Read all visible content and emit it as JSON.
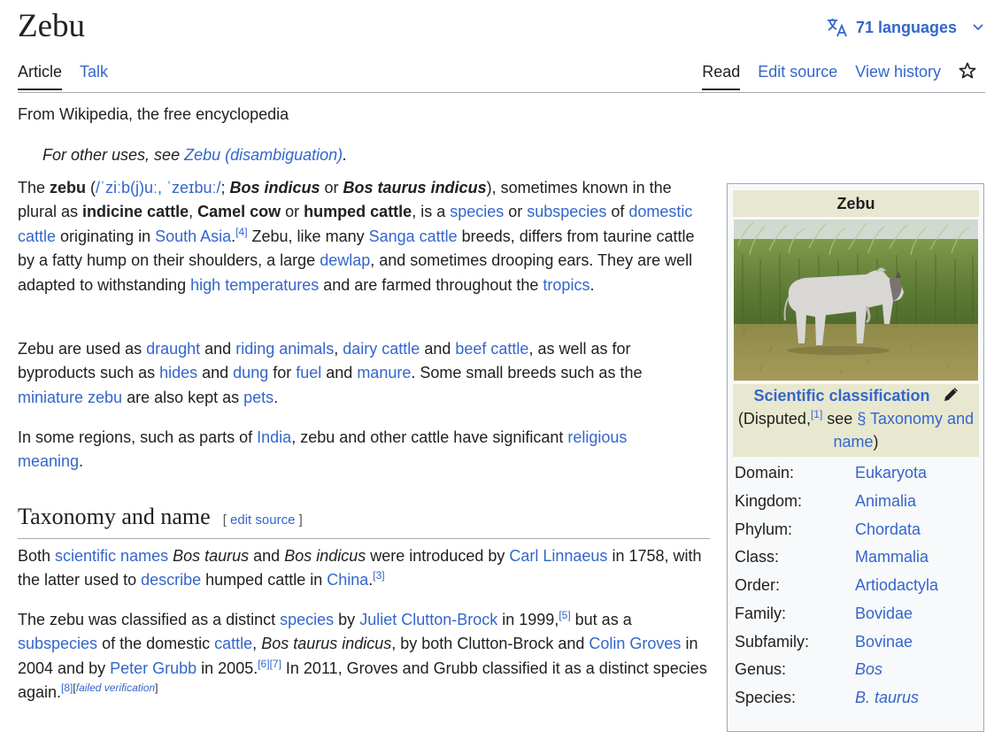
{
  "page": {
    "title": "Zebu",
    "languages": "71 languages",
    "tabs_left": [
      "Article",
      "Talk"
    ],
    "tabs_right": [
      "Read",
      "Edit source",
      "View history"
    ],
    "tagline": "From Wikipedia, the free encyclopedia",
    "hatnote_prefix": "For other uses, see ",
    "hatnote_link": "Zebu (disambiguation)",
    "hatnote_suffix": "."
  },
  "section": {
    "heading": "Taxonomy and name",
    "edit_open": "[ ",
    "edit_link": "edit source",
    "edit_close": " ]"
  },
  "infobox": {
    "title": "Zebu",
    "classification_heading": "Scientific classification",
    "disputed_prefix": "(Disputed,",
    "disputed_ref": "[1]",
    "disputed_mid": " see ",
    "disputed_link": "§ Taxonomy and name",
    "disputed_suffix": ")",
    "rows": [
      {
        "rank": "Domain:",
        "value": "Eukaryota"
      },
      {
        "rank": "Kingdom:",
        "value": "Animalia"
      },
      {
        "rank": "Phylum:",
        "value": "Chordata"
      },
      {
        "rank": "Class:",
        "value": "Mammalia"
      },
      {
        "rank": "Order:",
        "value": "Artiodactyla"
      },
      {
        "rank": "Family:",
        "value": "Bovidae"
      },
      {
        "rank": "Subfamily:",
        "value": "Bovinae"
      },
      {
        "rank": "Genus:",
        "value": "Bos"
      },
      {
        "rank": "Species:",
        "value": "B. taurus"
      }
    ]
  },
  "p1": {
    "t1": "The ",
    "b1": "zebu",
    "t2": " (",
    "ipa": "/ˈziːb(j)uː, ˈzeɪbuː/",
    "t3": "; ",
    "bi1": "Bos indicus",
    "t4": " or ",
    "bi2": "Bos taurus indicus",
    "t5": "), sometimes known in the plural as ",
    "b2": "indicine cattle",
    "t6": ", ",
    "b3": "Camel cow",
    "t7": " or ",
    "b4": "humped cattle",
    "t8": ", is a ",
    "l1": "species",
    "t9": " or ",
    "l2": "subspecies",
    "t10": " of ",
    "l3": "domestic cattle",
    "t11": " originating in ",
    "l4": "South Asia",
    "t12": ".",
    "r1": "[4]",
    "t13": " Zebu, like many ",
    "l5": "Sanga cattle",
    "t14": " breeds, differs from taurine cattle by a fatty hump on their shoulders, a large ",
    "l6": "dewlap",
    "t15": ", and sometimes drooping ears. They are well adapted to withstanding ",
    "l7": "high temperatures",
    "t16": " and are farmed throughout the ",
    "l8": "tropics",
    "t17": "."
  },
  "p2": {
    "t1": "Zebu are used as ",
    "l1": "draught",
    "t2": " and ",
    "l2": "riding animals",
    "t3": ", ",
    "l3": "dairy cattle",
    "t4": " and ",
    "l4": "beef cattle",
    "t5": ", as well as for byproducts such as ",
    "l5": "hides",
    "t6": " and ",
    "l6": "dung",
    "t7": " for ",
    "l7": "fuel",
    "t8": " and ",
    "l8": "manure",
    "t9": ". Some small breeds such as the ",
    "l9": "miniature zebu",
    "t10": " are also kept as ",
    "l10": "pets",
    "t11": "."
  },
  "p3": {
    "t1": "In some regions, such as parts of ",
    "l1": "India",
    "t2": ", zebu and other cattle have significant ",
    "l2": "religious meaning",
    "t3": "."
  },
  "p4": {
    "t1": "Both ",
    "l1": "scientific names",
    "t2": " ",
    "i1": "Bos taurus",
    "t3": " and ",
    "i2": "Bos indicus",
    "t4": " were introduced by ",
    "l2": "Carl Linnaeus",
    "t5": " in 1758, with the latter used to ",
    "l3": "describe",
    "t6": " humped cattle in ",
    "l4": "China",
    "t7": ".",
    "r1": "[3]"
  },
  "p5": {
    "t1": "The zebu was classified as a distinct ",
    "l1": "species",
    "t2": " by ",
    "l2": "Juliet Clutton-Brock",
    "t3": " in 1999,",
    "r1": "[5]",
    "t4": " but as a ",
    "l3": "subspecies",
    "t5": " of the domestic ",
    "l4": "cattle",
    "t6": ", ",
    "i1": "Bos taurus indicus",
    "t7": ", by both Clutton-Brock and ",
    "l5": "Colin Groves",
    "t8": " in 2004 and by ",
    "l6": "Peter Grubb",
    "t9": " in 2005.",
    "r2": "[6]",
    "r3": "[7]",
    "t10": " In 2011, Groves and Grubb classified it as a distinct species again.",
    "r4": "[8]",
    "fv_open": "[",
    "fv": "failed verification",
    "fv_close": "]"
  },
  "colors": {
    "link": "#3366cc",
    "text": "#202122",
    "infobox_header": "#e8e8d0",
    "rule": "#a2a9b1"
  },
  "icons": {
    "language": "translate-icon",
    "chevron": "chevron-down-icon",
    "watch": "star-icon",
    "edit": "pencil-icon"
  }
}
